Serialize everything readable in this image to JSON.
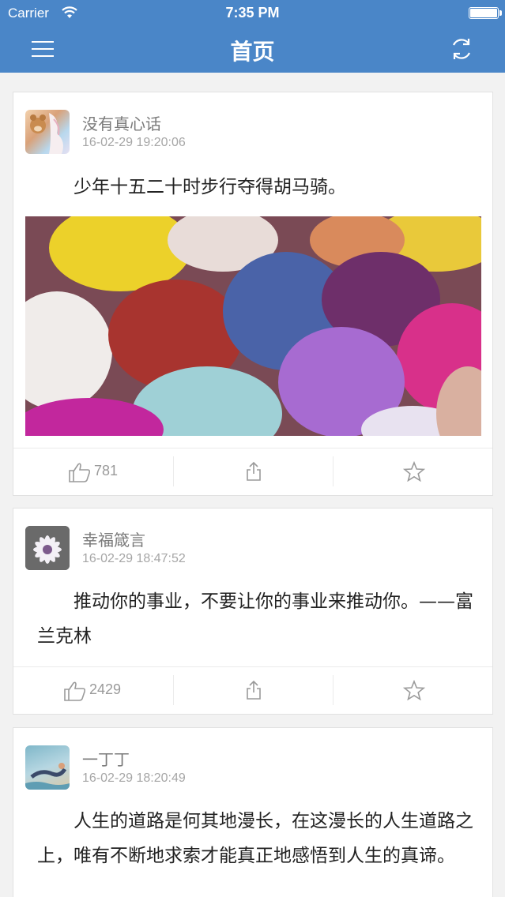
{
  "status_bar": {
    "carrier": "Carrier",
    "time": "7:35 PM"
  },
  "nav": {
    "title": "首页",
    "menu_icon": "hamburger-menu-icon",
    "refresh_icon": "refresh-icon"
  },
  "posts": [
    {
      "username": "没有真心话",
      "timestamp": "16-02-29 19:20:06",
      "content": "少年十五二十时步行夺得胡马骑。",
      "has_image": true,
      "likes": "781"
    },
    {
      "username": "幸福箴言",
      "timestamp": "16-02-29 18:47:52",
      "content": "推动你的事业，不要让你的事业来推动你。——富兰克林",
      "has_image": false,
      "likes": "2429"
    },
    {
      "username": "一丁丁",
      "timestamp": "16-02-29 18:20:49",
      "content": "人生的道路是何其地漫长，在这漫长的人生道路之上，唯有不断地求索才能真正地感悟到人生的真谛。",
      "has_image": false,
      "likes": ""
    }
  ],
  "colors": {
    "nav_bg": "#4a86c8",
    "page_bg": "#f2f2f2",
    "icon_gray": "#9a9a9a"
  }
}
